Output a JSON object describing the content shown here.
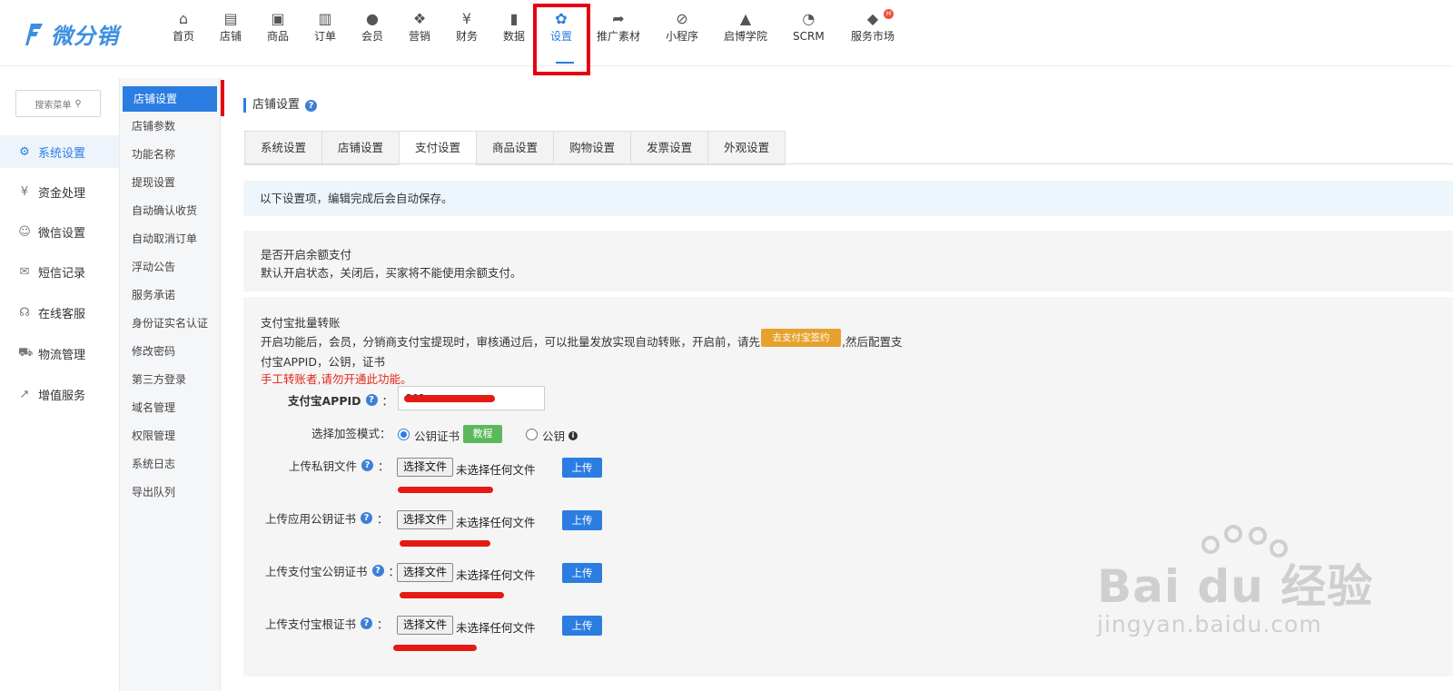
{
  "brand": {
    "name": "微分销"
  },
  "topnav": [
    {
      "label": "首页",
      "icon": "home-icon",
      "glyph": "⌂"
    },
    {
      "label": "店铺",
      "icon": "store-icon",
      "glyph": "▤"
    },
    {
      "label": "商品",
      "icon": "goods-icon",
      "glyph": "▣"
    },
    {
      "label": "订单",
      "icon": "order-icon",
      "glyph": "▥"
    },
    {
      "label": "会员",
      "icon": "member-icon",
      "glyph": "●"
    },
    {
      "label": "营销",
      "icon": "marketing-icon",
      "glyph": "❖"
    },
    {
      "label": "财务",
      "icon": "finance-icon",
      "glyph": "¥"
    },
    {
      "label": "数据",
      "icon": "data-icon",
      "glyph": "▮"
    },
    {
      "label": "设置",
      "icon": "settings-icon",
      "glyph": "✿",
      "active": true
    },
    {
      "label": "推广素材",
      "icon": "share-icon",
      "glyph": "➦"
    },
    {
      "label": "小程序",
      "icon": "miniapp-icon",
      "glyph": "⊘"
    },
    {
      "label": "启博学院",
      "icon": "academy-icon",
      "glyph": "▲"
    },
    {
      "label": "SCRM",
      "icon": "scrm-icon",
      "glyph": "◔"
    },
    {
      "label": "服务市场",
      "icon": "market-icon",
      "glyph": "◆",
      "badge": "H"
    }
  ],
  "search": {
    "placeholder": "搜索菜单"
  },
  "sidebar": [
    {
      "label": "系统设置",
      "icon": "settings-gear-icon",
      "glyph": "⚙",
      "active": true
    },
    {
      "label": "资金处理",
      "icon": "funds-icon",
      "glyph": "¥"
    },
    {
      "label": "微信设置",
      "icon": "wechat-icon",
      "glyph": "☺"
    },
    {
      "label": "短信记录",
      "icon": "mail-icon",
      "glyph": "✉"
    },
    {
      "label": "在线客服",
      "icon": "headset-icon",
      "glyph": "☊"
    },
    {
      "label": "物流管理",
      "icon": "truck-icon",
      "glyph": "⛟"
    },
    {
      "label": "增值服务",
      "icon": "chart-line-icon",
      "glyph": "↗"
    }
  ],
  "submenu": [
    {
      "label": "店铺设置",
      "active": true
    },
    {
      "label": "店铺参数"
    },
    {
      "label": "功能名称"
    },
    {
      "label": "提现设置"
    },
    {
      "label": "自动确认收货"
    },
    {
      "label": "自动取消订单"
    },
    {
      "label": "浮动公告"
    },
    {
      "label": "服务承诺"
    },
    {
      "label": "身份证实名认证"
    },
    {
      "label": "修改密码"
    },
    {
      "label": "第三方登录"
    },
    {
      "label": "域名管理"
    },
    {
      "label": "权限管理"
    },
    {
      "label": "系统日志"
    },
    {
      "label": "导出队列"
    }
  ],
  "page": {
    "title": "店铺设置",
    "tabs": [
      "系统设置",
      "店铺设置",
      "支付设置",
      "商品设置",
      "购物设置",
      "发票设置",
      "外观设置"
    ],
    "active_tab": "支付设置",
    "notice": "以下设置项，编辑完成后会自动保存。"
  },
  "balance": {
    "title": "是否开启余额支付",
    "desc": "默认开启状态，关闭后，买家将不能使用余额支付。"
  },
  "alipay": {
    "title": "支付宝批量转账",
    "desc_line1_a": "开启功能后，会员，分销商支付宝提现时，审核通过后，可以批量发放实现自动转账，开启前，请先",
    "sign_button": "去支付宝签约",
    "desc_line1_b": ",然后配置支",
    "desc_line2": "付宝APPID，公钥，证书",
    "warning": "手工转账者,请勿开通此功能。",
    "appid_label": "支付宝APPID",
    "appid_value": "202",
    "colon": "：",
    "sign_mode_label": "选择加签模式：",
    "mode_cert": "公钥证书",
    "tutorial_button": "教程",
    "mode_key": "公钥",
    "uploads": [
      {
        "label": "上传私钥文件"
      },
      {
        "label": "上传应用公钥证书"
      },
      {
        "label": "上传支付宝公钥证书"
      },
      {
        "label": "上传支付宝根证书"
      }
    ],
    "choose_file": "选择文件",
    "no_file": "未选择任何文件",
    "upload_button": "上传"
  },
  "watermark": {
    "main": "Bai du 经验",
    "sub": "jingyan.baidu.com"
  },
  "colors": {
    "primary": "#2b7de1",
    "warn": "#e0271c",
    "sign": "#e6a22d",
    "tutorial": "#5cb85c",
    "annotation": "#e60012"
  }
}
